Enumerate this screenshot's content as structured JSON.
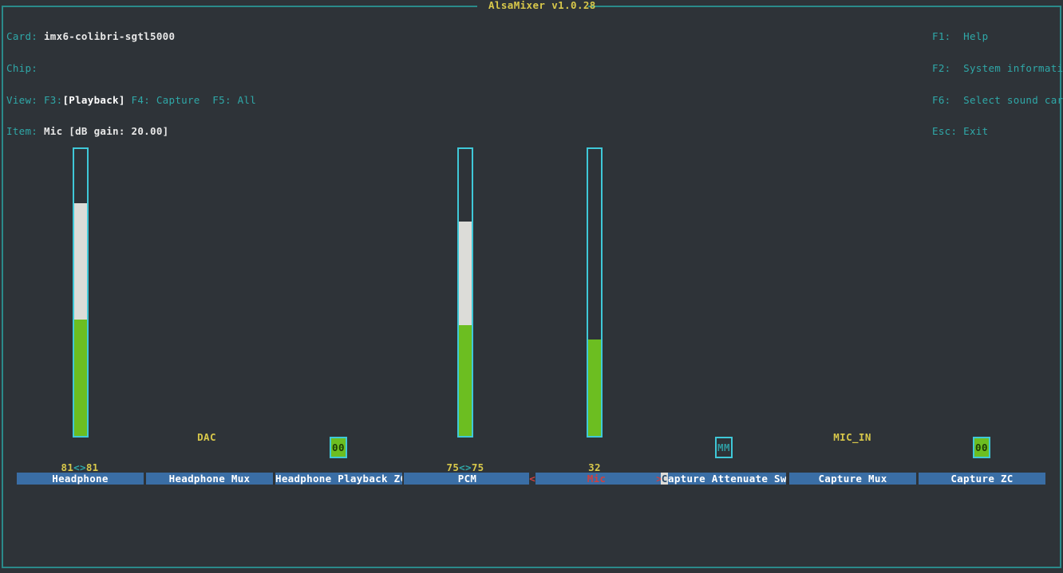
{
  "window": {
    "title": "AlsaMixer v1.0.28"
  },
  "header": {
    "card_label": "Card:",
    "card_value": "imx6-colibri-sgtl5000",
    "chip_label": "Chip:",
    "chip_value": "",
    "view_label": "View:",
    "view_f3": "F3:",
    "view_f3_value": "[Playback]",
    "view_f4": "F4: Capture",
    "view_f5": "F5: All",
    "item_label": "Item:",
    "item_value": "Mic [dB gain: 20.00]"
  },
  "help": {
    "lines": [
      {
        "key": "F1:",
        "text": "Help"
      },
      {
        "key": "F2:",
        "text": "System information"
      },
      {
        "key": "F6:",
        "text": "Select sound card"
      },
      {
        "key": "Esc:",
        "text": "Exit"
      }
    ]
  },
  "controls": [
    {
      "name": "Headphone",
      "type": "slider",
      "readout": "81<>81",
      "left_value": "81",
      "separator": "<>",
      "right_value": "81",
      "channel_label": "",
      "meter_green_pct": 81,
      "meter_grey_pct": 40,
      "selected": false
    },
    {
      "name": "Headphone Mux",
      "type": "enum",
      "readout": "",
      "channel_label": "DAC",
      "selected": false
    },
    {
      "name": "Headphone Playback ZC",
      "type": "switch",
      "readout": "",
      "chip_text": "00",
      "chip_state": "on",
      "selected": false
    },
    {
      "name": "PCM",
      "type": "slider",
      "readout": "75<>75",
      "left_value": "75",
      "separator": "<>",
      "right_value": "75",
      "channel_label": "",
      "meter_green_pct": 75,
      "meter_grey_pct": 38,
      "selected": false
    },
    {
      "name": "Mic",
      "type": "slider",
      "readout": "32",
      "left_value": "32",
      "separator": "",
      "right_value": "",
      "channel_label": "",
      "meter_green_pct": 32,
      "meter_grey_pct": 0,
      "selected": true,
      "left_arrow": "<",
      "right_arrow": ">"
    },
    {
      "name": "Capture Attenuate Switch",
      "type": "switch",
      "readout": "",
      "chip_text": "MM",
      "chip_state": "mute",
      "selected": false,
      "cursor_char": "C",
      "rest_label": "apture Attenuate Switch"
    },
    {
      "name": "Capture Mux",
      "type": "enum",
      "readout": "",
      "channel_label": "MIC_IN",
      "selected": false
    },
    {
      "name": "Capture ZC",
      "type": "switch",
      "readout": "",
      "chip_text": "00",
      "chip_state": "on",
      "selected": false
    }
  ],
  "colors": {
    "background": "#2e3338",
    "frame": "#2a8a8a",
    "title": "#d8c84a",
    "accent_cyan": "#2fa8a8",
    "meter_border": "#3fc8d8",
    "meter_green": "#6cbe21",
    "meter_grey": "#dcdcd8",
    "control_bar": "#3a6ea5",
    "selected_red": "#d04040",
    "value_yellow": "#d8c84a"
  }
}
